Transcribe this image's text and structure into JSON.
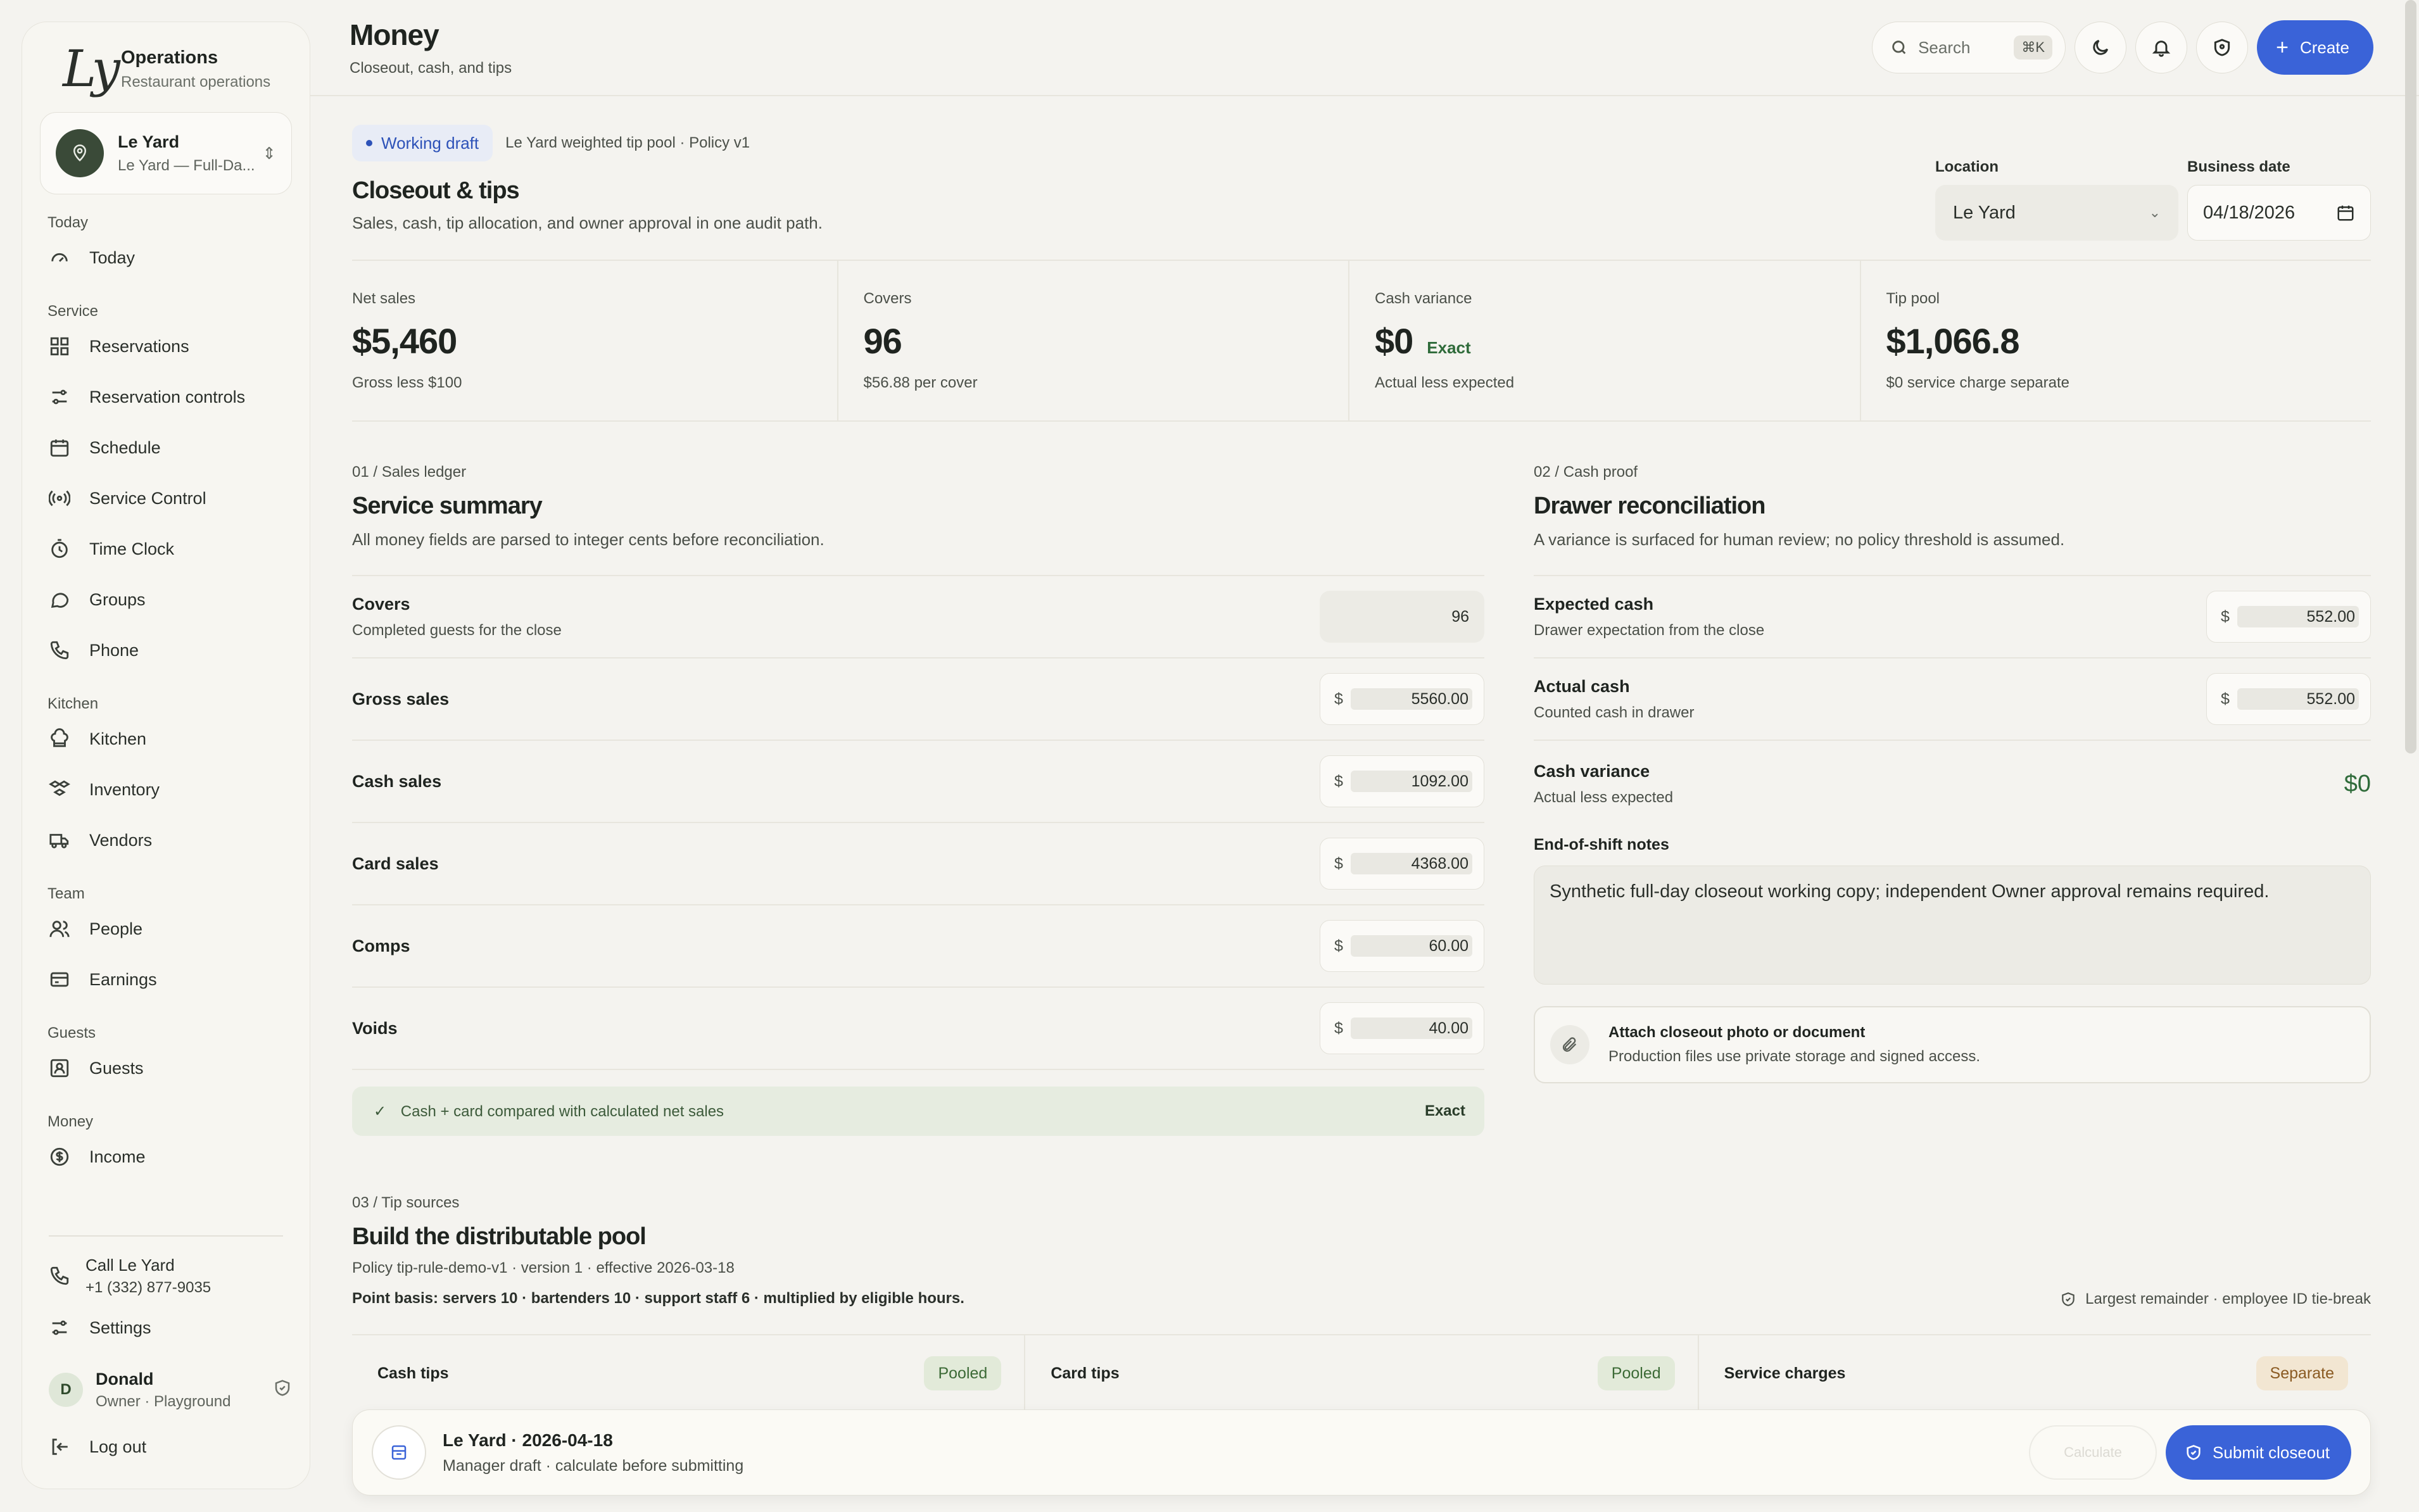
{
  "sidebar": {
    "brand": {
      "logo": "Ly",
      "title": "Operations",
      "subtitle": "Restaurant operations"
    },
    "venue": {
      "name": "Le Yard",
      "detail": "Le Yard — Full-Da..."
    },
    "sections": {
      "today": "Today",
      "service": "Service",
      "kitchen": "Kitchen",
      "team": "Team",
      "guests": "Guests",
      "money": "Money"
    },
    "items": {
      "today": "Today",
      "reservations": "Reservations",
      "reservation_controls": "Reservation controls",
      "schedule": "Schedule",
      "service_control": "Service Control",
      "time_clock": "Time Clock",
      "groups": "Groups",
      "phone": "Phone",
      "kitchen": "Kitchen",
      "inventory": "Inventory",
      "vendors": "Vendors",
      "people": "People",
      "earnings": "Earnings",
      "guests": "Guests",
      "income": "Income"
    },
    "call": {
      "title": "Call Le Yard",
      "number": "+1 (332) 877-9035"
    },
    "settings": "Settings",
    "user": {
      "initial": "D",
      "name": "Donald",
      "role": "Owner · Playground"
    },
    "logout": "Log out"
  },
  "header": {
    "title": "Money",
    "subtitle": "Closeout, cash, and tips",
    "search_label": "Search",
    "search_shortcut": "⌘K",
    "create_label": "Create"
  },
  "closeout": {
    "status": "Working draft",
    "policy": "Le Yard weighted tip pool · Policy v1",
    "title": "Closeout & tips",
    "subtitle": "Sales, cash, tip allocation, and owner approval in one audit path.",
    "location_label": "Location",
    "location_value": "Le Yard",
    "date_label": "Business date",
    "date_value": "04/18/2026"
  },
  "stats": [
    {
      "label": "Net sales",
      "value": "$5,460",
      "tag": "",
      "note": "Gross less $100"
    },
    {
      "label": "Covers",
      "value": "96",
      "tag": "",
      "note": "$56.88 per cover"
    },
    {
      "label": "Cash variance",
      "value": "$0",
      "tag": "Exact",
      "note": "Actual less expected"
    },
    {
      "label": "Tip pool",
      "value": "$1,066.8",
      "tag": "",
      "note": "$0 service charge separate"
    }
  ],
  "sales": {
    "label": "01 / Sales ledger",
    "title": "Service summary",
    "subtitle": "All money fields are parsed to integer cents before reconciliation.",
    "currency": "$",
    "covers": {
      "title": "Covers",
      "sub": "Completed guests for the close",
      "value": "96"
    },
    "gross": {
      "title": "Gross sales",
      "value": "5560.00"
    },
    "cash": {
      "title": "Cash sales",
      "value": "1092.00"
    },
    "card": {
      "title": "Card sales",
      "value": "4368.00"
    },
    "comps": {
      "title": "Comps",
      "value": "60.00"
    },
    "voids": {
      "title": "Voids",
      "value": "40.00"
    },
    "match_text": "Cash + card compared with calculated net sales",
    "match_status": "Exact"
  },
  "cash_proof": {
    "label": "02 / Cash proof",
    "title": "Drawer reconciliation",
    "subtitle": "A variance is surfaced for human review; no policy threshold is assumed.",
    "currency": "$",
    "expected": {
      "title": "Expected cash",
      "sub": "Drawer expectation from the close",
      "value": "552.00"
    },
    "actual": {
      "title": "Actual cash",
      "sub": "Counted cash in drawer",
      "value": "552.00"
    },
    "variance": {
      "title": "Cash variance",
      "sub": "Actual less expected",
      "value": "$0"
    },
    "notes_label": "End-of-shift notes",
    "notes_value": "Synthetic full-day closeout working copy; independent Owner approval remains required.",
    "attach_title": "Attach closeout photo or document",
    "attach_sub": "Production files use private storage and signed access."
  },
  "tips": {
    "label": "03 / Tip sources",
    "title": "Build the distributable pool",
    "policy_line": "Policy tip-rule-demo-v1 · version 1 · effective 2026-03-18",
    "point_basis": "Point basis: servers 10 · bartenders 10 · support staff 6 · multiplied by eligible hours.",
    "remainder": "Largest remainder · employee ID tie-break",
    "sources": [
      {
        "name": "Cash tips",
        "badge": "Pooled"
      },
      {
        "name": "Card tips",
        "badge": "Pooled"
      },
      {
        "name": "Service charges",
        "badge": "Separate"
      }
    ]
  },
  "bottom_bar": {
    "title": "Le Yard · 2026-04-18",
    "subtitle": "Manager draft · calculate before submitting",
    "secondary_label": "Calculate",
    "submit_label": "Submit closeout"
  },
  "colors": {
    "accent": "#3a63d8",
    "background": "#f4f3ef",
    "success": "#2f6b3a",
    "warning": "#8a5a22"
  }
}
